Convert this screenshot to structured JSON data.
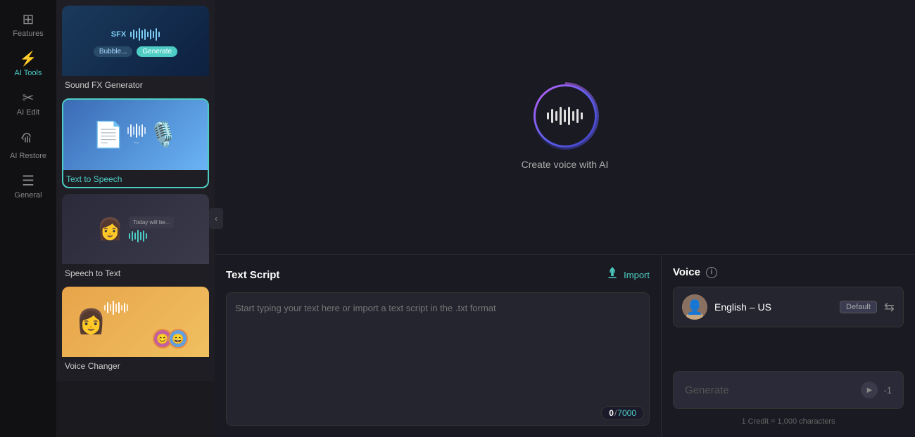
{
  "nav": {
    "items": [
      {
        "id": "features",
        "label": "Features",
        "icon": "⊞",
        "active": false
      },
      {
        "id": "ai-tools",
        "label": "AI Tools",
        "icon": "⚡",
        "active": true
      },
      {
        "id": "ai-edit",
        "label": "AI Edit",
        "icon": "✂️",
        "active": false
      },
      {
        "id": "ai-restore",
        "label": "AI Restore",
        "icon": "🎵",
        "active": false
      },
      {
        "id": "general",
        "label": "General",
        "icon": "☰",
        "active": false
      }
    ]
  },
  "sidebar": {
    "cards": [
      {
        "id": "sound-fx",
        "label": "Sound FX Generator",
        "active": false,
        "type": "sound-fx"
      },
      {
        "id": "text-to-speech",
        "label": "Text to Speech",
        "active": true,
        "type": "tts"
      },
      {
        "id": "speech-to-text",
        "label": "Speech to Text",
        "active": false,
        "type": "stt"
      },
      {
        "id": "voice-changer",
        "label": "Voice Changer",
        "active": false,
        "type": "vc"
      }
    ]
  },
  "preview": {
    "create_voice_label": "Create voice with AI"
  },
  "text_script": {
    "panel_title": "Text Script",
    "import_label": "Import",
    "placeholder": "Start typing your text here or import a text script in the .txt format",
    "char_current": "0",
    "char_max": "7000"
  },
  "voice": {
    "panel_title": "Voice",
    "voice_name": "English – US",
    "default_badge": "Default",
    "generate_label": "Generate",
    "credit_cost": "-1",
    "credit_info": "1 Credit = 1,000 characters"
  }
}
